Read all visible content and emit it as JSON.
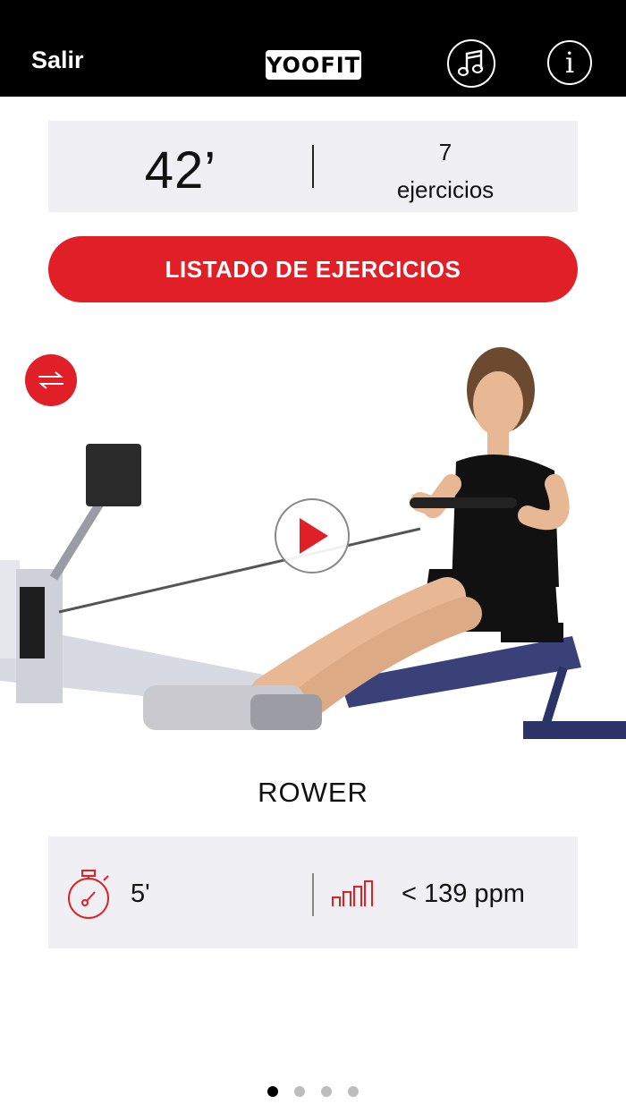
{
  "header": {
    "exit_label": "Salir",
    "logo_text": "YOOFIT",
    "icons": [
      "music-icon",
      "info-icon"
    ],
    "info_glyph": "i"
  },
  "summary": {
    "total_time": "42’",
    "exercise_count": "7",
    "exercise_count_label": "ejercicios"
  },
  "list_button_label": "LISTADO DE EJERCICIOS",
  "exercise": {
    "name": "ROWER",
    "duration": "5'",
    "heart_rate": "< 139 ppm"
  },
  "pagination": {
    "total": 4,
    "active_index": 0
  },
  "colors": {
    "accent": "#e01f26",
    "header_bg": "#000000",
    "panel_bg": "#f0f0f4"
  }
}
